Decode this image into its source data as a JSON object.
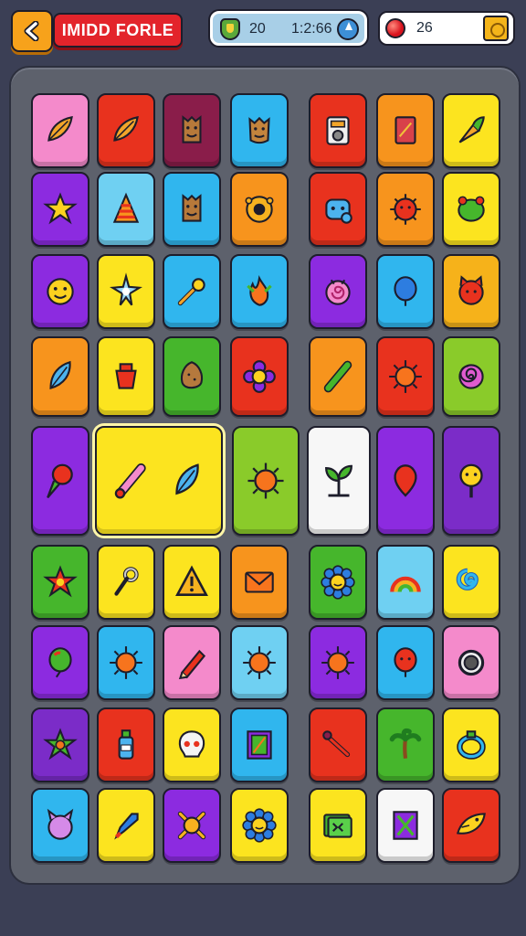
{
  "hud": {
    "title": "IMIDD FORLE",
    "stat_value_1": "20",
    "stat_value_2": "1:2:66",
    "gems": "26"
  },
  "colors": {
    "red": "#e8321e",
    "orange": "#f7941d",
    "yellow": "#fce41f",
    "green": "#46b62c",
    "lime": "#8acb2a",
    "cyan": "#30b6ee",
    "skyblue": "#6fd0f2",
    "purple": "#8c2be0",
    "violet": "#7b2cc8",
    "pink": "#f48acb",
    "maroon": "#8a1d4a",
    "white": "#f7f7f7",
    "gold": "#f6b21a"
  },
  "board": {
    "rows": [
      [
        {
          "color": "pink",
          "icon": "leaf"
        },
        {
          "color": "red",
          "icon": "leaf"
        },
        {
          "color": "maroon",
          "icon": "wooden-totem"
        },
        {
          "color": "cyan",
          "icon": "wooden-face"
        },
        {
          "color": "red",
          "icon": "radio"
        },
        {
          "color": "orange",
          "icon": "book"
        },
        {
          "color": "yellow",
          "icon": "carrot"
        }
      ],
      [
        {
          "color": "purple",
          "icon": "star"
        },
        {
          "color": "skyblue",
          "icon": "striped-cone"
        },
        {
          "color": "cyan",
          "icon": "wooden-totem"
        },
        {
          "color": "orange",
          "icon": "donut"
        },
        {
          "color": "red",
          "icon": "blue-monster"
        },
        {
          "color": "orange",
          "icon": "red-spiky-ball"
        },
        {
          "color": "yellow",
          "icon": "green-frog"
        }
      ],
      [
        {
          "color": "purple",
          "icon": "smiley"
        },
        {
          "color": "yellow",
          "icon": "crystal-burst"
        },
        {
          "color": "cyan",
          "icon": "wand"
        },
        {
          "color": "cyan",
          "icon": "orange-flame"
        },
        {
          "color": "purple",
          "icon": "pink-swirl"
        },
        {
          "color": "cyan",
          "icon": "blue-balloon"
        },
        {
          "color": "gold",
          "icon": "red-cat"
        }
      ],
      [
        {
          "color": "orange",
          "icon": "blue-leaf"
        },
        {
          "color": "yellow",
          "icon": "red-pot"
        },
        {
          "color": "green",
          "icon": "potato"
        },
        {
          "color": "red",
          "icon": "flower"
        },
        {
          "color": "orange",
          "icon": "green-stick"
        },
        {
          "color": "red",
          "icon": "sun"
        },
        {
          "color": "lime",
          "icon": "spiral"
        }
      ],
      [
        {
          "color": "purple",
          "icon": "ice-cream"
        },
        {
          "color": "yellow",
          "icon": "candy-stick"
        },
        {
          "color": "lime",
          "icon": "sun"
        },
        {
          "color": "white",
          "icon": "plant"
        },
        {
          "color": "purple",
          "icon": "balloon"
        },
        {
          "color": "violet",
          "icon": "lollipop"
        }
      ],
      [
        {
          "color": "green",
          "icon": "red-star"
        },
        {
          "color": "yellow",
          "icon": "key"
        },
        {
          "color": "yellow",
          "icon": "warning"
        },
        {
          "color": "orange",
          "icon": "envelope"
        },
        {
          "color": "green",
          "icon": "smiley-flower"
        },
        {
          "color": "skyblue",
          "icon": "rainbow"
        },
        {
          "color": "yellow",
          "icon": "blue-spiral"
        }
      ],
      [
        {
          "color": "purple",
          "icon": "green-balloon"
        },
        {
          "color": "cyan",
          "icon": "sun"
        },
        {
          "color": "pink",
          "icon": "pencil"
        },
        {
          "color": "skyblue",
          "icon": "sun"
        },
        {
          "color": "purple",
          "icon": "sun"
        },
        {
          "color": "cyan",
          "icon": "red-balloon"
        },
        {
          "color": "pink",
          "icon": "ring"
        }
      ],
      [
        {
          "color": "violet",
          "icon": "green-star"
        },
        {
          "color": "red",
          "icon": "bottle"
        },
        {
          "color": "yellow",
          "icon": "skull"
        },
        {
          "color": "cyan",
          "icon": "picture-frame"
        },
        {
          "color": "red",
          "icon": "bat"
        },
        {
          "color": "green",
          "icon": "palm-tree"
        },
        {
          "color": "yellow",
          "icon": "blue-ring"
        }
      ],
      [
        {
          "color": "cyan",
          "icon": "pink-cat"
        },
        {
          "color": "yellow",
          "icon": "rocket"
        },
        {
          "color": "purple",
          "icon": "cross-sun"
        },
        {
          "color": "yellow",
          "icon": "smiley-flower"
        },
        {
          "color": "yellow",
          "icon": "green-card"
        },
        {
          "color": "white",
          "icon": "crossed-box"
        },
        {
          "color": "red",
          "icon": "fish"
        }
      ]
    ]
  }
}
